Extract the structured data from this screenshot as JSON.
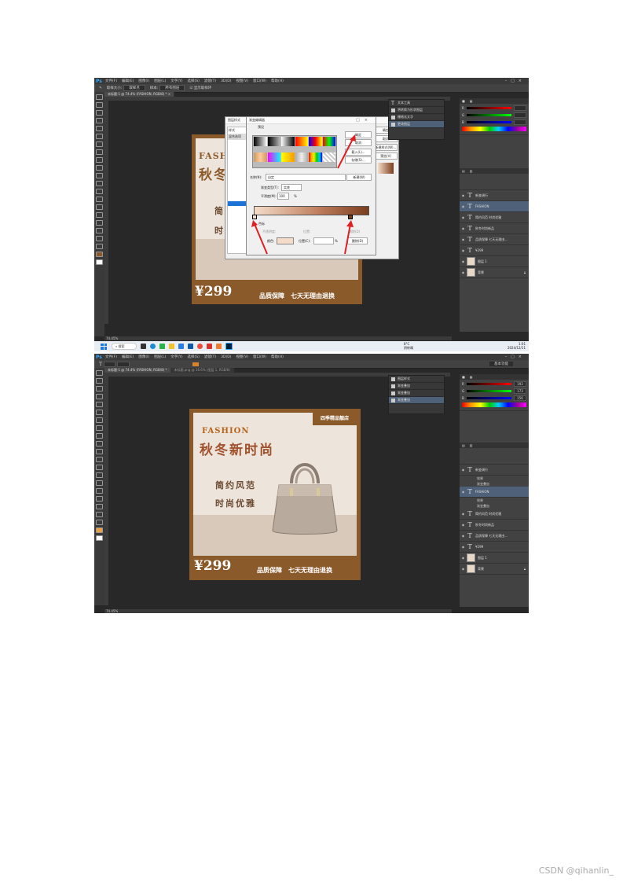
{
  "app": {
    "logo": "Ps"
  },
  "menu": [
    "文件(F)",
    "编辑(E)",
    "图像(I)",
    "图层(L)",
    "文字(Y)",
    "选择(S)",
    "滤镜(T)",
    "3D(D)",
    "视图(V)",
    "窗口(W)",
    "帮助(H)"
  ],
  "shot1": {
    "options": [
      "取样大小:",
      "取样点",
      "样本:",
      "所有图层",
      "显示取样环"
    ],
    "doc_tab": "未标题-1 @ 74.4% (FASHION, RGB/8) * ×",
    "zoom": "74.45%",
    "history": [
      "文本工具",
      "将转换为形状图层",
      "栅格化文字",
      "更改图层"
    ],
    "dialog_style": {
      "title": "图层样式",
      "style_label": "样式",
      "blend_label": "混合选项"
    },
    "dialog_gradient": {
      "title": "渐变编辑器",
      "presets_label": "预设",
      "ok": "确定",
      "cancel": "取消",
      "load": "载入(L)...",
      "save": "存储(S)...",
      "name_label": "名称(N):",
      "name_value": "自定",
      "new": "新建(W)",
      "type_label": "渐变类型(T):",
      "type_value": "实底",
      "smooth_label": "平滑度(M):",
      "smooth_value": "100",
      "percent": "%",
      "stops_label": "色标",
      "opacity_label": "不透明度:",
      "location_label": "位置:",
      "delete_label": "删除(D)",
      "color_label": "颜色:",
      "location2_label": "位置(C):",
      "delete2_label": "删除(D)"
    },
    "side_buttons": [
      "确定",
      "取消",
      "新建样式(W)...",
      "预览(V)"
    ],
    "layers": [
      "新变调行",
      "FASHION",
      "简约风范 时尚优雅",
      "秋冬时尚新品",
      "品质保障 七天无理由...",
      "¥299",
      "图层 1",
      "背景"
    ],
    "selected_layer": 1,
    "taskbar": {
      "search": "搜索",
      "weather_temp": "8°C",
      "weather_desc": "阴转晴",
      "time": "1:01",
      "date": "2024/12/11"
    }
  },
  "shot2": {
    "doc_tab": "未标题-1 @ 74.4% (FASHION, RGB/8) *",
    "doc_tab2": "未标题.png @ 16.6% (图层 1, RGB/8)",
    "zoom": "74.45%",
    "preset": "基本功能",
    "history": [
      "图层样式",
      "渐变叠加",
      "渐变叠加",
      "渐变叠加"
    ],
    "color_values": [
      "193",
      "173",
      "156"
    ],
    "layers": [
      {
        "name": "新变调行",
        "effects": [
          "效果",
          "渐变叠加"
        ]
      },
      {
        "name": "FASHION",
        "effects": [
          "效果",
          "渐变叠加"
        ]
      },
      {
        "name": "简约风范 时尚优雅",
        "effects": []
      },
      {
        "name": "秋冬时尚新品",
        "effects": []
      },
      {
        "name": "品质保障 七天无理由...",
        "effects": []
      },
      {
        "name": "¥299",
        "effects": []
      },
      {
        "name": "图层 1",
        "effects": []
      },
      {
        "name": "背景",
        "effects": []
      }
    ],
    "selected_layer": 1
  },
  "design": {
    "fashion": "FASHION",
    "headline": "秋冬新时尚",
    "sub1": "简约风范",
    "sub2": "时尚优雅",
    "brand": "四季精品靓店",
    "price": "¥299",
    "slogan": "品质保障　七天无理由退换"
  },
  "watermark": "CSDN @qihanlin_",
  "colors": {
    "brown": "#8b5a2b",
    "cream": "#ede4dc",
    "ps_dark": "#282828",
    "ps_panel": "#424242",
    "arrow": "#e02020"
  }
}
